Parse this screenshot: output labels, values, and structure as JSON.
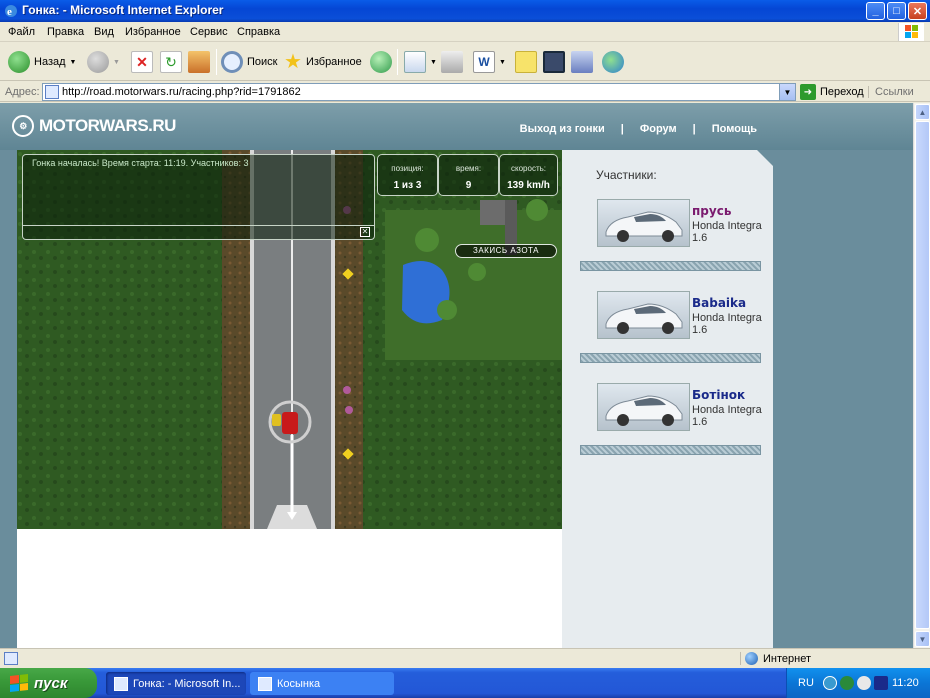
{
  "window": {
    "title": "Гонка: - Microsoft Internet Explorer",
    "btn_min": "_",
    "btn_max": "□",
    "btn_close": "✕"
  },
  "menu": [
    "Файл",
    "Правка",
    "Вид",
    "Избранное",
    "Сервис",
    "Справка"
  ],
  "toolbar": {
    "back_label": "Назад",
    "search_label": "Поиск",
    "favorites_label": "Избранное"
  },
  "address": {
    "label": "Адрес:",
    "url": "http://road.motorwars.ru/racing.php?rid=1791862",
    "go_label": "Переход",
    "links_label": "Ссылки"
  },
  "site": {
    "logo": "MOTORWARS.RU",
    "nav": [
      "Выход из гонки",
      "|",
      "Форум",
      "|",
      "Помощь"
    ]
  },
  "game": {
    "chat_message": "Гонка началась! Время старта: 11:19. Участников: 3",
    "stats": [
      {
        "label": "позиция:",
        "value": "1 из 3"
      },
      {
        "label": "время:",
        "value": "9"
      },
      {
        "label": "скорость:",
        "value": "139 km/h"
      }
    ],
    "nitro_button": "ЗАКИСЬ АЗОТА",
    "close_glyph": "✕"
  },
  "participants": {
    "title": "Участники:",
    "list": [
      {
        "name": "прусь",
        "name_color": "#7a1a6e",
        "model": "Honda Integra 1.6"
      },
      {
        "name": "Babaika",
        "name_color": "#1a2a8a",
        "model": "Honda Integra 1.6"
      },
      {
        "name": "Ботiнок",
        "name_color": "#1a2a8a",
        "model": "Honda Integra 1.6"
      }
    ]
  },
  "statusbar": {
    "zone": "Интернет"
  },
  "taskbar": {
    "start_label": "пуск",
    "tasks": [
      "Гонка: - Microsoft In...",
      "Косынка"
    ],
    "lang": "RU",
    "clock": "11:20"
  },
  "colors": {
    "accent": "#245edb",
    "site_bg": "#6a8d9c"
  }
}
